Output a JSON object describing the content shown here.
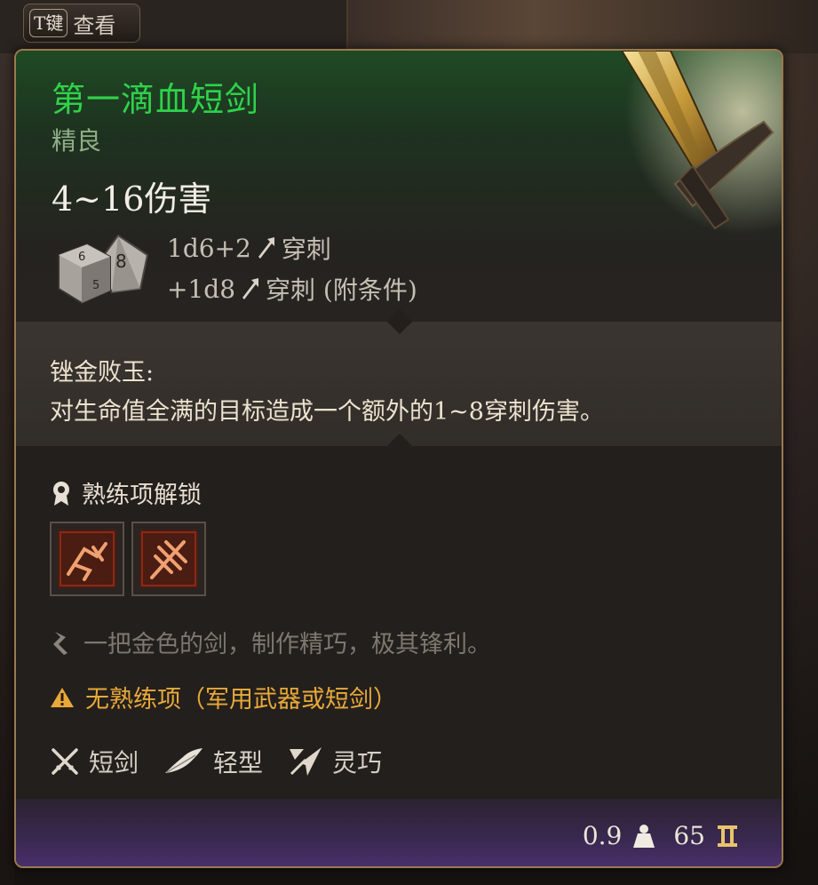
{
  "background": {
    "key_hint": {
      "key": "T键",
      "label": "查看"
    }
  },
  "item": {
    "name": "第一滴血短剑",
    "rarity": "精良",
    "damage_total": "4~16伤害",
    "damage_lines": [
      {
        "dice": "1d6+2",
        "type": "穿刺"
      },
      {
        "dice": "+1d8",
        "type": "穿刺 (附条件)"
      }
    ],
    "ability": {
      "name": "锉金败玉:",
      "description": "对生命值全满的目标造成一个额外的1~8穿刺伤害。"
    },
    "proficiency_unlock": {
      "label": "熟练项解锁"
    },
    "flavor_text": "一把金色的剑，制作精巧，极其锋利。",
    "warning": "无熟练项（军用武器或短剑）",
    "properties": [
      {
        "icon": "crossed-swords-icon",
        "label": "短剑"
      },
      {
        "icon": "feather-icon",
        "label": "轻型"
      },
      {
        "icon": "finesse-icon",
        "label": "灵巧"
      }
    ],
    "weight": "0.9",
    "value": "65"
  },
  "colors": {
    "name": "#2fd24a",
    "rarity": "#8fae86",
    "warning": "#e8a93a",
    "border": "#9a7a4e",
    "footer_purple": "#48306a"
  }
}
